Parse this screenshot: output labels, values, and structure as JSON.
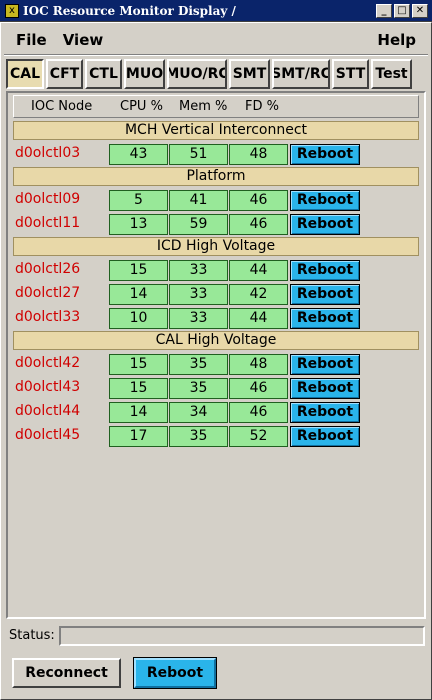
{
  "window": {
    "title": "IOC Resource Monitor Display /",
    "app_icon": "x",
    "controls": {
      "minimize": "_",
      "maximize": "□",
      "close": "✕"
    }
  },
  "menu": {
    "file": "File",
    "view": "View",
    "help": "Help"
  },
  "tabs": [
    {
      "label": "CAL",
      "active": true
    },
    {
      "label": "CFT"
    },
    {
      "label": "CTL"
    },
    {
      "label": "MUO"
    },
    {
      "label": "MUO/RC"
    },
    {
      "label": "SMT"
    },
    {
      "label": "SMT/RC"
    },
    {
      "label": "STT"
    },
    {
      "label": "Test"
    }
  ],
  "table": {
    "headers": {
      "node": "IOC Node",
      "cpu": "CPU %",
      "mem": "Mem %",
      "fd": "FD %"
    },
    "reboot_label": "Reboot",
    "groups": [
      {
        "name": "MCH Vertical Interconnect"
      },
      {
        "name": "Platform"
      },
      {
        "name": "ICD High Voltage"
      },
      {
        "name": "CAL High Voltage"
      }
    ],
    "rows": [
      {
        "node": "d0olctl03",
        "cpu": "43",
        "mem": "51",
        "fd": "48"
      },
      {
        "node": "d0olctl09",
        "cpu": "5",
        "mem": "41",
        "fd": "46"
      },
      {
        "node": "d0olctl11",
        "cpu": "13",
        "mem": "59",
        "fd": "46"
      },
      {
        "node": "d0olctl26",
        "cpu": "15",
        "mem": "33",
        "fd": "44"
      },
      {
        "node": "d0olctl27",
        "cpu": "14",
        "mem": "33",
        "fd": "42"
      },
      {
        "node": "d0olctl33",
        "cpu": "10",
        "mem": "33",
        "fd": "44"
      },
      {
        "node": "d0olctl42",
        "cpu": "15",
        "mem": "35",
        "fd": "48"
      },
      {
        "node": "d0olctl43",
        "cpu": "15",
        "mem": "35",
        "fd": "46"
      },
      {
        "node": "d0olctl44",
        "cpu": "14",
        "mem": "34",
        "fd": "46"
      },
      {
        "node": "d0olctl45",
        "cpu": "17",
        "mem": "35",
        "fd": "52"
      }
    ]
  },
  "status": {
    "label": "Status:",
    "value": ""
  },
  "footer": {
    "reconnect": "Reconnect",
    "reboot": "Reboot"
  },
  "colors": {
    "node_text": "#d00000",
    "value_bg": "#98e898",
    "reboot_bg": "#2ab4ea",
    "group_bg": "#e8d8a8",
    "active_tab_bg": "#e8dcb0",
    "titlebar_bg": "#0a246a"
  }
}
